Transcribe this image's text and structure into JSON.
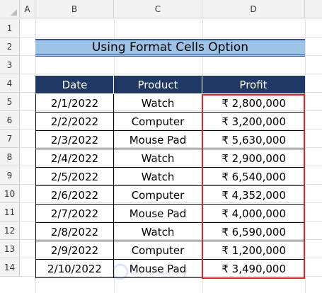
{
  "column_headers": [
    "A",
    "B",
    "C",
    "D"
  ],
  "row_headers": [
    "1",
    "2",
    "3",
    "4",
    "5",
    "6",
    "7",
    "8",
    "9",
    "10",
    "11",
    "12",
    "13",
    "14"
  ],
  "title": "Using Format Cells Option",
  "table": {
    "headers": [
      "Date",
      "Product",
      "Profit"
    ],
    "rows": [
      [
        "2/1/2022",
        "Watch",
        "₹ 2,800,000"
      ],
      [
        "2/2/2022",
        "Computer",
        "₹ 3,200,000"
      ],
      [
        "2/3/2022",
        "Mouse Pad",
        "₹ 5,630,000"
      ],
      [
        "2/4/2022",
        "Watch",
        "₹ 2,900,000"
      ],
      [
        "2/5/2022",
        "Watch",
        "₹ 6,540,000"
      ],
      [
        "2/6/2022",
        "Computer",
        "₹ 4,352,000"
      ],
      [
        "2/7/2022",
        "Mouse Pad",
        "₹ 4,000,000"
      ],
      [
        "2/8/2022",
        "Watch",
        "₹ 6,590,000"
      ],
      [
        "2/9/2022",
        "Computer",
        "₹ 1,200,000"
      ],
      [
        "2/10/2022",
        "Mouse Pad",
        "₹ 3,490,000"
      ]
    ]
  },
  "watermark": "exceldemy",
  "colors": {
    "title_fill": "#9dc3e6",
    "header_fill": "#1f3864",
    "selection_border": "#e0242b"
  }
}
